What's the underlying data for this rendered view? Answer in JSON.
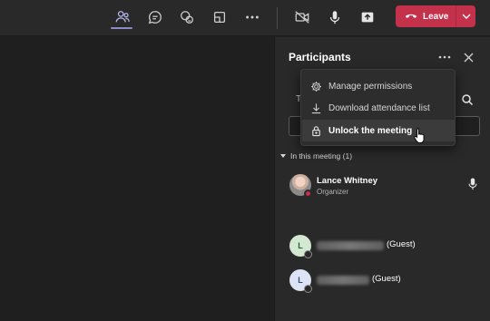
{
  "toolbar": {
    "buttons": [
      {
        "icon": "people-icon",
        "active": true
      },
      {
        "icon": "chat-icon"
      },
      {
        "icon": "reactions-icon"
      },
      {
        "icon": "share-screen-icon"
      },
      {
        "icon": "more-icon"
      },
      {
        "icon": "camera-off-icon"
      },
      {
        "icon": "mic-icon"
      },
      {
        "icon": "share-tray-icon"
      }
    ],
    "leave_label": "Leave",
    "accent_color": "#c4314b",
    "active_indicator_color": "#8b8cc7"
  },
  "panel": {
    "title": "Participants",
    "search_letter": "T",
    "section_label": "In this meeting (1)",
    "participants": [
      {
        "name": "Lance Whitney",
        "role": "Organizer",
        "mic": true,
        "avatar": "photo"
      },
      {
        "initial": "L",
        "suffix": "(Guest)"
      },
      {
        "initial": "L",
        "suffix": "(Guest)"
      }
    ]
  },
  "menu": {
    "items": [
      {
        "label": "Manage permissions",
        "icon": "gear-icon"
      },
      {
        "label": "Download attendance list",
        "icon": "download-icon"
      },
      {
        "label": "Unlock the meeting",
        "icon": "lock-icon",
        "hovered": true
      }
    ]
  }
}
